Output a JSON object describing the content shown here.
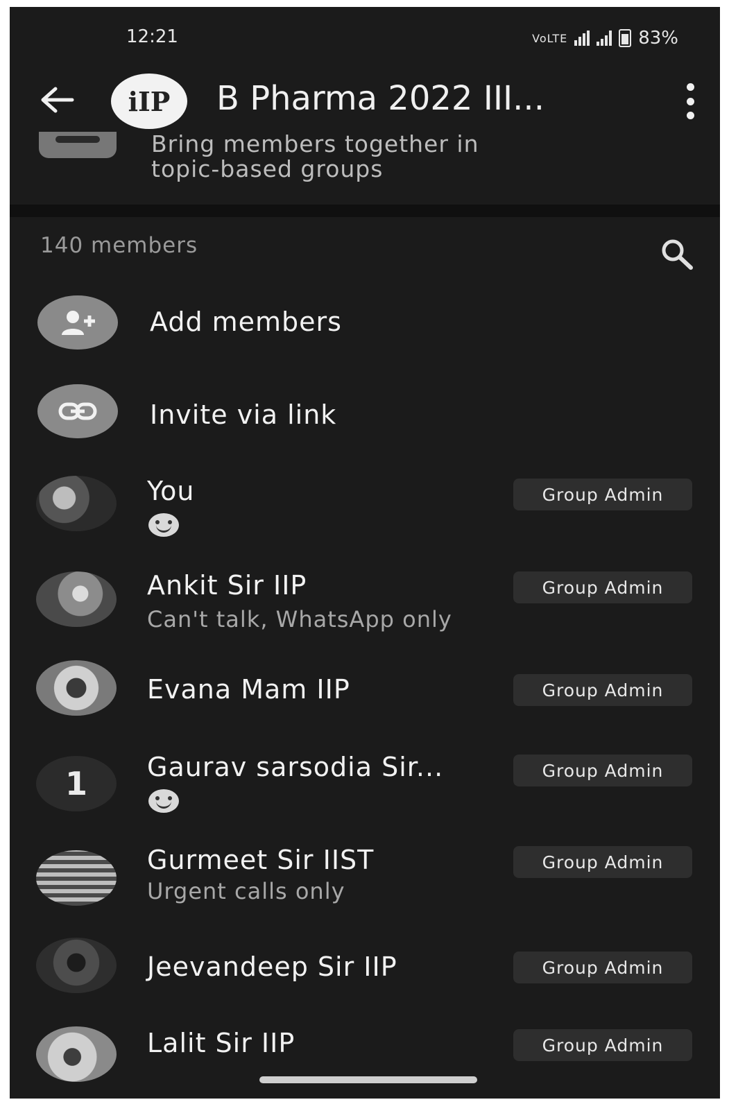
{
  "status_bar": {
    "time": "12:21",
    "network_label": "VoLTE",
    "battery": "83%"
  },
  "header": {
    "group_title": "B Pharma 2022 III...",
    "avatar_text": "iIP"
  },
  "community": {
    "line1": "Bring members together in",
    "line2": "topic-based groups"
  },
  "members_header": {
    "count": "140 members"
  },
  "actions": [
    {
      "label": "Add members",
      "icon": "add-person-icon"
    },
    {
      "label": "Invite via link",
      "icon": "link-icon"
    }
  ],
  "members": [
    {
      "name": "You",
      "status": "",
      "status_emoji": true,
      "badge": "Group Admin",
      "avatar_tone": "#6a6a6a"
    },
    {
      "name": "Ankit Sir IIP",
      "status": "Can't talk, WhatsApp only",
      "status_emoji": false,
      "badge": "Group Admin",
      "avatar_tone": "#8c8c8c"
    },
    {
      "name": "Evana Mam IIP",
      "status": "",
      "status_emoji": false,
      "badge": "Group Admin",
      "avatar_tone": "#b0b0b0"
    },
    {
      "name": "Gaurav sarsodia Sir...",
      "status": "",
      "status_emoji": true,
      "badge": "Group Admin",
      "avatar_tone": "#2b2b2b",
      "avatar_text": "1"
    },
    {
      "name": "Gurmeet Sir IIST",
      "status": "Urgent calls only",
      "status_emoji": false,
      "badge": "Group Admin",
      "avatar_tone": "#555555"
    },
    {
      "name": "Jeevandeep Sir IIP",
      "status": "",
      "status_emoji": false,
      "badge": "Group Admin",
      "avatar_tone": "#3c3c3c"
    },
    {
      "name": "Lalit Sir IIP",
      "status": "",
      "status_emoji": false,
      "badge": "Group Admin",
      "avatar_tone": "#9a9a9a"
    }
  ]
}
